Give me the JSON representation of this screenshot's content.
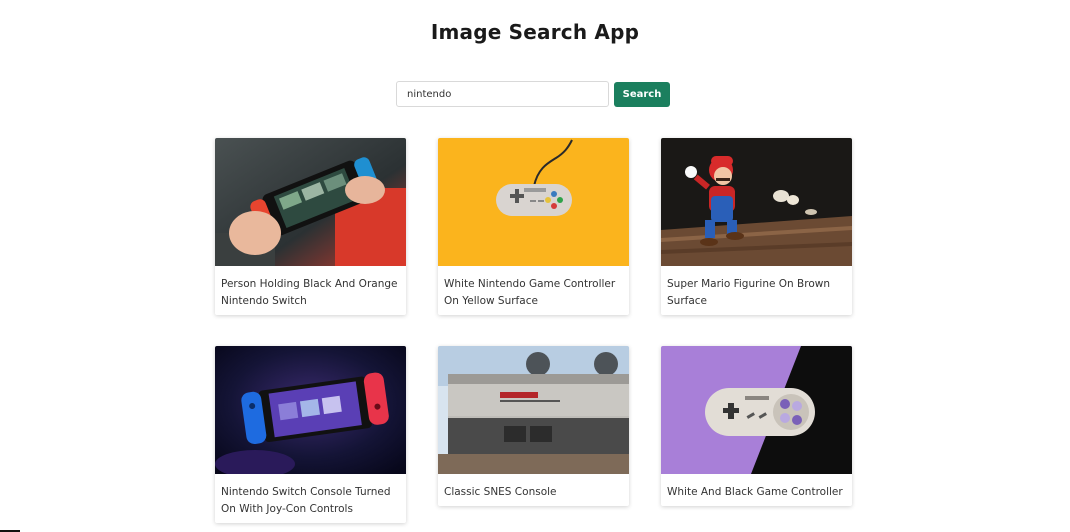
{
  "header": {
    "title": "Image Search App"
  },
  "search": {
    "value": "nintendo",
    "button_label": "Search"
  },
  "results": [
    {
      "caption": "Person Holding Black And Orange Nintendo Switch",
      "image": "handheld-switch-orange"
    },
    {
      "caption": "White Nintendo Game Controller On Yellow Surface",
      "image": "snes-controller-yellow"
    },
    {
      "caption": "Super Mario Figurine On Brown Surface",
      "image": "mario-figurine"
    },
    {
      "caption": "Nintendo Switch Console Turned On With Joy-Con Controls",
      "image": "switch-neon-blue"
    },
    {
      "caption": "Classic SNES Console",
      "image": "nes-console"
    },
    {
      "caption": "White And Black Game Controller",
      "image": "snes-controller-purple"
    }
  ],
  "colors": {
    "accent": "#1b7f5e",
    "page_bg": "#ffffff"
  }
}
